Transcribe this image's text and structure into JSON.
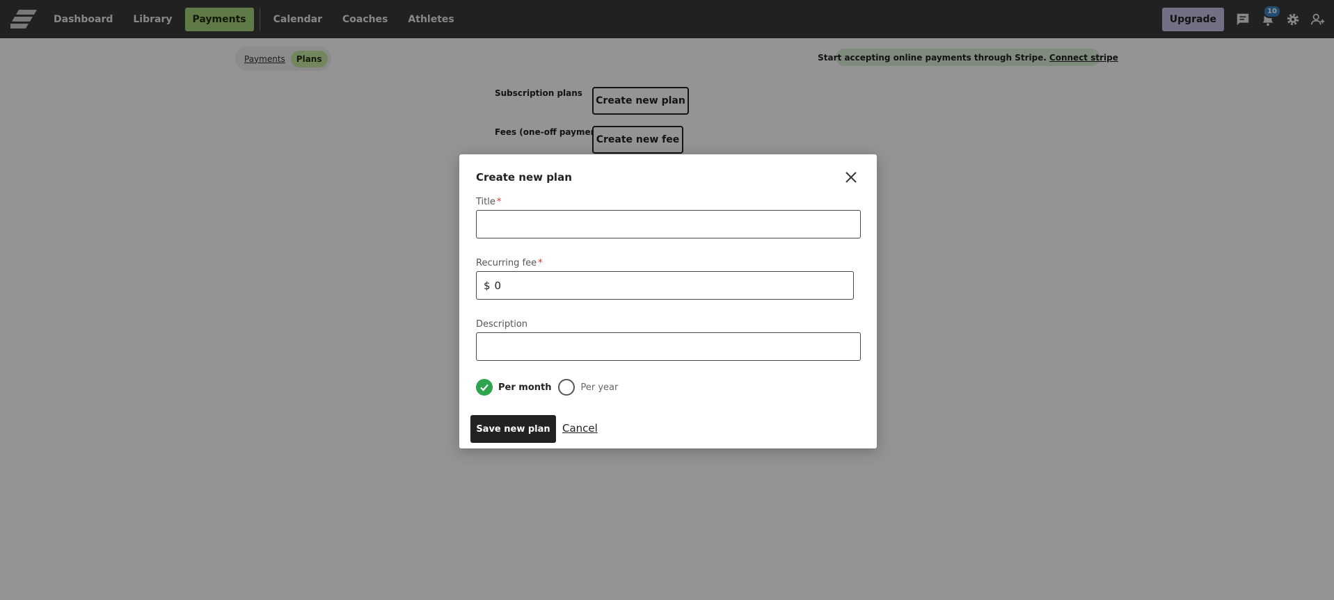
{
  "nav": {
    "items": [
      {
        "label": "Dashboard",
        "active": false
      },
      {
        "label": "Library",
        "active": false
      },
      {
        "label": "Payments",
        "active": true
      },
      {
        "label": "Calendar",
        "active": false
      },
      {
        "label": "Coaches",
        "active": false
      },
      {
        "label": "Athletes",
        "active": false
      }
    ],
    "upgrade_label": "Upgrade",
    "notification_count": "10",
    "icons": [
      "chat-icon",
      "bell-icon",
      "gear-icon",
      "user-add-icon"
    ],
    "active_color": "#a6d37b",
    "upgrade_color": "#c9c1e3"
  },
  "subtabs": [
    {
      "label": "Payments",
      "active": false
    },
    {
      "label": "Plans",
      "active": true
    }
  ],
  "stripe_banner": {
    "text": "Start accepting online payments through Stripe.",
    "link": "Connect stripe"
  },
  "page": {
    "subscription_label": "Subscription plans",
    "create_plan_label": "Create new plan",
    "fees_label": "Fees (one-off payments)",
    "create_fee_label": "Create new fee"
  },
  "modal": {
    "title": "Create new plan",
    "title_field": {
      "label": "Title",
      "required_mark": "*",
      "value": ""
    },
    "fee_field": {
      "label": "Recurring fee",
      "required_mark": "*",
      "currency": "$",
      "value": "0"
    },
    "description_field": {
      "label": "Description",
      "value": ""
    },
    "period_options": [
      {
        "label": "Per month",
        "checked": true
      },
      {
        "label": "Per year",
        "checked": false
      }
    ],
    "save_label": "Save new plan",
    "cancel_label": "Cancel",
    "check_color": "#2ea44f"
  }
}
